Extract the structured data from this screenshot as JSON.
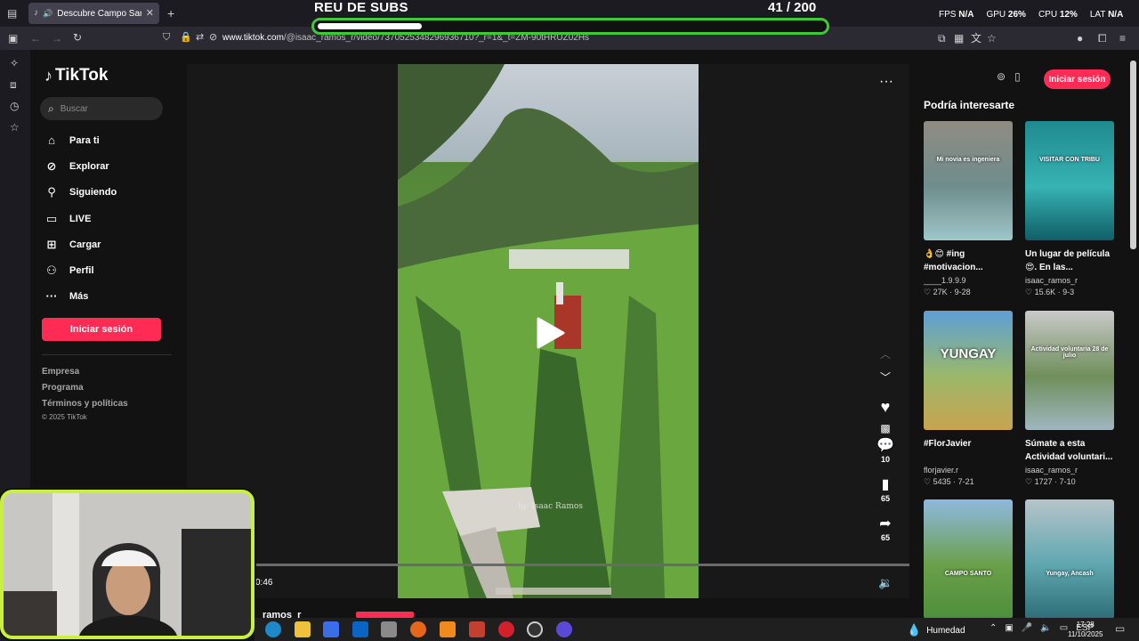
{
  "browser": {
    "tab_title": "Descubre Campo Santo de",
    "url_domain": "www.tiktok.com",
    "url_path": "/@isaac_ramos_r/video/7370525348296936710?_r=1&_t=ZM-90tHRUZ02Hs"
  },
  "overlay": {
    "subs_title": "REU DE SUBS",
    "subs_count": "41  / 200",
    "subs_progress": 0.205,
    "perf": [
      {
        "label": "FPS",
        "value": "N/A"
      },
      {
        "label": "GPU",
        "value": "26%"
      },
      {
        "label": "CPU",
        "value": "12%"
      },
      {
        "label": "LAT",
        "value": "N/A"
      }
    ]
  },
  "tiktok": {
    "logo": "TikTok",
    "search_placeholder": "Buscar",
    "nav": [
      {
        "label": "Para ti",
        "icon": "home-icon"
      },
      {
        "label": "Explorar",
        "icon": "compass-icon"
      },
      {
        "label": "Siguiendo",
        "icon": "following-icon"
      },
      {
        "label": "LIVE",
        "icon": "live-icon"
      },
      {
        "label": "Cargar",
        "icon": "upload-icon"
      },
      {
        "label": "Perfil",
        "icon": "profile-icon"
      },
      {
        "label": "Más",
        "icon": "more-icon"
      }
    ],
    "login_label": "Iniciar sesión",
    "footer": [
      "Empresa",
      "Programa",
      "Términos y políticas",
      "© 2025 TikTok"
    ]
  },
  "video": {
    "watermark": "Ig: Isaac Ramos",
    "time": "0:46",
    "author": "ramos_r"
  },
  "actions": {
    "comments": "10",
    "saves": "65",
    "shares": "65"
  },
  "right_panel": {
    "login_label": "Iniciar sesión",
    "title": "Podría interesarte",
    "cards": [
      {
        "title": "👌😊 #ing #motivacion...",
        "user": "____1.9.9.9",
        "likes": "27K",
        "date": "9-28",
        "colors": [
          "#8f8b83",
          "#6f8d8c",
          "#9fc6c9"
        ],
        "overlay": "Mi novia es ingeniera"
      },
      {
        "title": "Un lugar de película 😍. En las...",
        "user": "isaac_ramos_r",
        "likes": "15.6K",
        "date": "9-3",
        "colors": [
          "#1f8a90",
          "#37b3b4",
          "#0f5f66"
        ],
        "overlay": "VISITAR CON TRIBU"
      },
      {
        "title": "#FlorJavier",
        "user": "florjavier.r",
        "likes": "5435",
        "date": "7-21",
        "colors": [
          "#5e9fd6",
          "#9bb86a",
          "#c9a34f"
        ],
        "overlay": "YUNGAY"
      },
      {
        "title": "Súmate a esta Actividad voluntari...",
        "user": "isaac_ramos_r",
        "likes": "1727",
        "date": "7-10",
        "colors": [
          "#c9c9c9",
          "#6f8f5b",
          "#9fb6c0"
        ],
        "overlay": "Actividad voluntaria 28 de julio"
      },
      {
        "title": "",
        "user": "",
        "likes": "",
        "date": "",
        "colors": [
          "#8fb8e0",
          "#6aa04a",
          "#4f8e3a"
        ],
        "overlay": "CAMPO SANTO"
      },
      {
        "title": "",
        "user": "",
        "likes": "",
        "date": "",
        "colors": [
          "#b6c4c9",
          "#5fa7b0",
          "#2e6e78"
        ],
        "overlay": "Yungay, Ancash"
      }
    ]
  },
  "taskbar": {
    "weather": "Humedad",
    "lang": "ESP",
    "time": "17:28",
    "date": "11/10/2025"
  }
}
